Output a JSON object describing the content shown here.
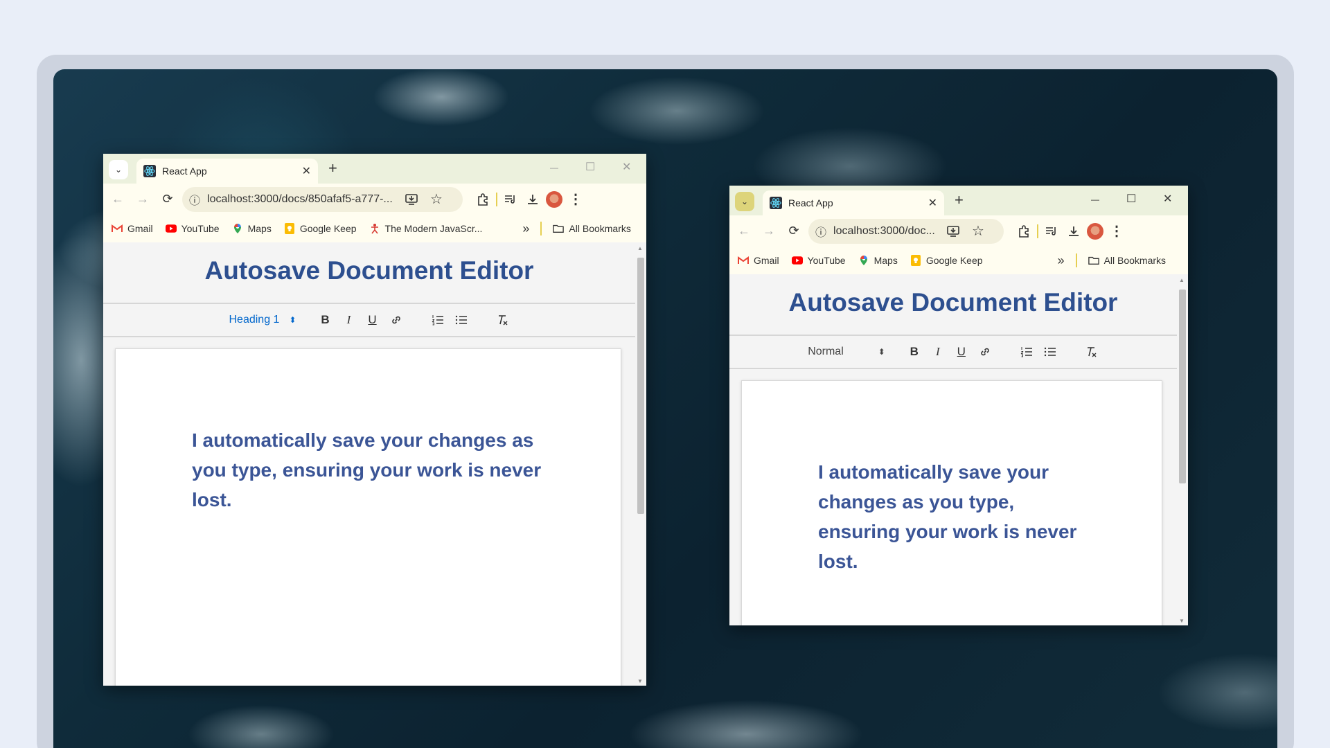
{
  "windows": [
    {
      "tab_title": "React App",
      "url": "localhost:3000/docs/850afaf5-a777-...",
      "bookmarks": [
        "Gmail",
        "YouTube",
        "Maps",
        "Google Keep",
        "The Modern JavaScr..."
      ],
      "all_bookmarks": "All Bookmarks",
      "app_title": "Autosave Document Editor",
      "format_select": "Heading 1",
      "content": "I automatically save your changes as you type, ensuring your work is never lost."
    },
    {
      "tab_title": "React App",
      "url": "localhost:3000/doc...",
      "bookmarks": [
        "Gmail",
        "YouTube",
        "Maps",
        "Google Keep"
      ],
      "all_bookmarks": "All Bookmarks",
      "app_title": "Autosave Document Editor",
      "format_select": "Normal",
      "content": "I automatically save your changes as you type, ensuring your work is never lost."
    }
  ],
  "glyphs": {
    "back": "←",
    "forward": "→",
    "reload": "⟳",
    "close": "✕",
    "plus": "+",
    "minimize": "—",
    "maximize": "☐",
    "chevron_down": "⌄",
    "info": "ⓘ",
    "star": "☆",
    "menu": "⋮",
    "download": "⤓",
    "more": "»",
    "bold": "B",
    "italic": "I",
    "underline": "U",
    "select_arrows": "⬍",
    "clean": "T"
  },
  "colors": {
    "accent_title": "#2d4f8f",
    "doc_text": "#3b5596",
    "tabbar": "#ecf1dd",
    "chrome": "#fffdf0"
  }
}
